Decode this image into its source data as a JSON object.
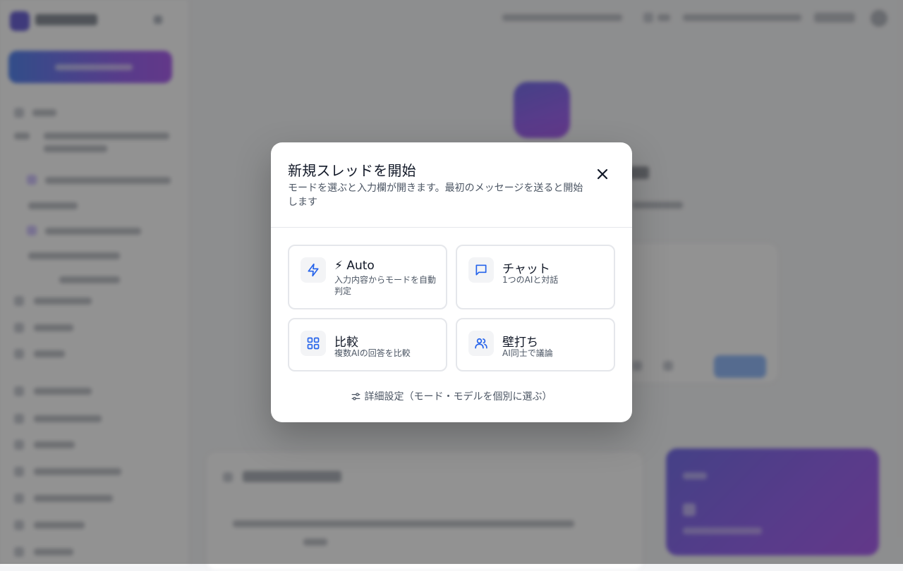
{
  "modal": {
    "title": "新規スレッドを開始",
    "description": "モードを選ぶと入力欄が開きます。最初のメッセージを送ると開始します",
    "close_icon": "close-icon",
    "modes": [
      {
        "title": "⚡ Auto",
        "subtitle": "入力内容からモードを自動判定",
        "icon": "lightning-icon"
      },
      {
        "title": "チャット",
        "subtitle": "1つのAIと対話",
        "icon": "chat-bubble-icon"
      },
      {
        "title": "比較",
        "subtitle": "複数AIの回答を比較",
        "icon": "grid-icon"
      },
      {
        "title": "壁打ち",
        "subtitle": "AI同士で議論",
        "icon": "users-icon"
      }
    ],
    "advanced_label": "詳細設定（モード・モデルを個別に選ぶ）",
    "advanced_icon": "sliders-icon"
  },
  "colors": {
    "accent": "#2563eb",
    "overlay": "rgba(60,60,60,0.56)",
    "brand_gradient_start": "#2563eb",
    "brand_gradient_end": "#9333ea"
  }
}
